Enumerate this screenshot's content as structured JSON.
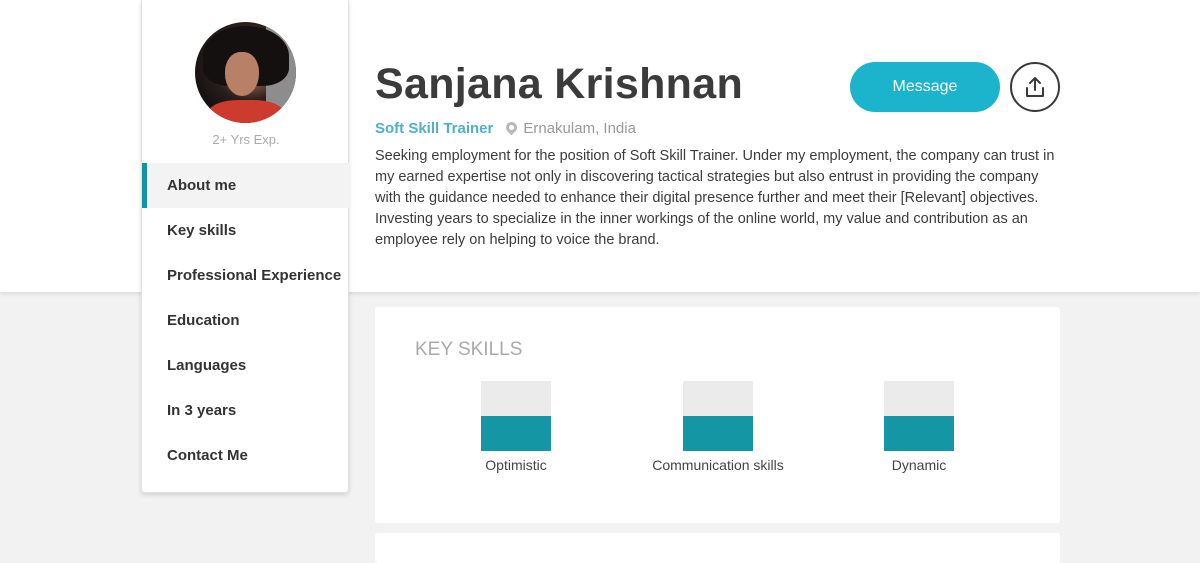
{
  "profile": {
    "name": "Sanjana Krishnan",
    "role": "Soft Skill Trainer",
    "location": "Ernakulam, India",
    "experience": "2+ Yrs Exp.",
    "about": "Seeking employment for the position of Soft Skill Trainer. Under my employment, the company can trust in my earned expertise not only in discovering tactical strategies but also entrust in providing the company with the guidance needed to enhance their digital presence further and meet their [Relevant] objectives. Investing years to specialize in the inner workings of the online world, my value and contribution as an employee rely on helping to voice the brand."
  },
  "actions": {
    "message_label": "Message",
    "share_icon": "share-upload-icon"
  },
  "sidebar": {
    "items": [
      {
        "label": "About me",
        "active": true
      },
      {
        "label": "Key skills"
      },
      {
        "label": "Professional Experience"
      },
      {
        "label": "Education"
      },
      {
        "label": "Languages"
      },
      {
        "label": "In 3 years"
      },
      {
        "label": "Contact Me"
      }
    ]
  },
  "key_skills": {
    "title": "KEY SKILLS",
    "skills": [
      {
        "label": "Optimistic",
        "level": 0.5
      },
      {
        "label": "Communication skills",
        "level": 0.5
      },
      {
        "label": "Dynamic",
        "level": 0.5
      }
    ]
  },
  "colors": {
    "accent": "#1cb3cc",
    "nav_active_border": "#1593a6",
    "skill_fill": "#1496a5",
    "role_text": "#4fb0c6"
  }
}
